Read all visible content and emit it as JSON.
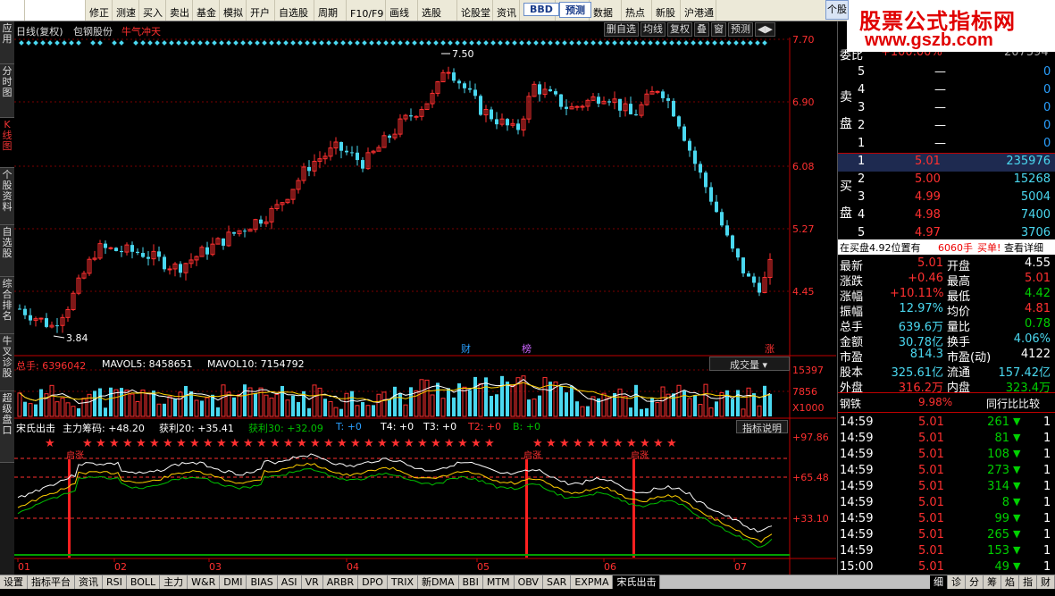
{
  "toolbar": {
    "items": [
      "",
      "",
      "修正",
      "测速",
      "买入",
      "卖出",
      "基金",
      "模拟",
      "开户",
      "自选股",
      "周期",
      "F10/F9",
      "画线",
      "选股",
      "论股堂",
      "资讯",
      "BBD",
      "预测",
      "数据",
      "热点",
      "新股",
      "沪港通",
      "个股"
    ]
  },
  "brand": {
    "line1": "股票公式指标网",
    "line2": "www.gszb.com"
  },
  "left_tabs": [
    "应用",
    "分时图",
    "K线图",
    "个股资料",
    "自选股",
    "综合排名",
    "牛叉诊股",
    "超级盘口"
  ],
  "chart_header": {
    "period": "日线(复权)",
    "name": "包钢股份",
    "tag": "牛气冲天",
    "buttons": [
      "删自选",
      "均线",
      "复权",
      "叠",
      "窗",
      "预测",
      "◀▶"
    ]
  },
  "price_axis": [
    "7.70",
    "6.90",
    "6.08",
    "5.27",
    "4.45"
  ],
  "annotations": {
    "high": "7.50",
    "low": "3.84",
    "marks": [
      "财",
      "榜",
      "涨"
    ]
  },
  "volume_header": {
    "total": "总手: 6396042",
    "mavol5": "MAVOL5: 8458651",
    "mavol10": "MAVOL10: 7154792",
    "selector": "成交量",
    "axis": [
      "15397",
      "7856",
      "X1000"
    ]
  },
  "indicator_header": {
    "name": "宋氏出击",
    "zl": "主力筹码: +48.20",
    "hl20": "获利20: +35.41",
    "hl30": "获利30: +32.09",
    "t": "T: +0",
    "t4": "T4: +0",
    "t3": "T3: +0",
    "t2": "T2: +0",
    "b": "B: +0",
    "help": "指标说明",
    "axis": [
      "+97.86",
      "+65.48",
      "+33.10"
    ],
    "labels": [
      "启涨",
      "启涨",
      "启涨"
    ]
  },
  "months": [
    "01",
    "02",
    "03",
    "04",
    "05",
    "06",
    "07"
  ],
  "quote": {
    "wei_bi": "委比",
    "wei_bi_val": "+100.00%",
    "wei_cha": "207594",
    "sell_label": "卖盘",
    "buy_label": "买盘",
    "sells": [
      {
        "n": "5",
        "p": "—",
        "v": "0"
      },
      {
        "n": "4",
        "p": "—",
        "v": "0"
      },
      {
        "n": "3",
        "p": "—",
        "v": "0"
      },
      {
        "n": "2",
        "p": "—",
        "v": "0"
      },
      {
        "n": "1",
        "p": "—",
        "v": "0"
      }
    ],
    "buys": [
      {
        "n": "1",
        "p": "5.01",
        "v": "235976"
      },
      {
        "n": "2",
        "p": "5.00",
        "v": "15268"
      },
      {
        "n": "3",
        "p": "4.99",
        "v": "5004"
      },
      {
        "n": "4",
        "p": "4.98",
        "v": "7400"
      },
      {
        "n": "5",
        "p": "4.97",
        "v": "3706"
      }
    ],
    "bar": {
      "left": "在买盘4.92位置有",
      "mid": "6060手",
      "buy": "买单!",
      "detail": "查看详细"
    },
    "stats": [
      {
        "l1": "最新",
        "v1": "5.01",
        "c1": "red",
        "l2": "开盘",
        "v2": "4.55",
        "c2": "white"
      },
      {
        "l1": "涨跌",
        "v1": "+0.46",
        "c1": "red",
        "l2": "最高",
        "v2": "5.01",
        "c2": "red"
      },
      {
        "l1": "涨幅",
        "v1": "+10.11%",
        "c1": "red",
        "l2": "最低",
        "v2": "4.42",
        "c2": "green"
      },
      {
        "l1": "振幅",
        "v1": "12.97%",
        "c1": "cyan",
        "l2": "均价",
        "v2": "4.81",
        "c2": "red"
      },
      {
        "l1": "总手",
        "v1": "639.6万",
        "c1": "cyan",
        "l2": "量比",
        "v2": "0.78",
        "c2": "green"
      },
      {
        "l1": "金额",
        "v1": "30.78亿",
        "c1": "cyan",
        "l2": "换手",
        "v2": "4.06%",
        "c2": "cyan"
      },
      {
        "l1": "市盈",
        "v1": "814.3",
        "c1": "cyan",
        "l2": "市盈(动)",
        "v2": "4122",
        "c2": "white"
      },
      {
        "l1": "股本",
        "v1": "325.61亿",
        "c1": "cyan",
        "l2": "流通",
        "v2": "157.42亿",
        "c2": "cyan"
      },
      {
        "l1": "外盘",
        "v1": "316.2万",
        "c1": "red",
        "l2": "内盘",
        "v2": "323.4万",
        "c2": "green"
      }
    ],
    "industry": {
      "name": "钢铁",
      "pct": "9.98%",
      "cmp": "同行比比较"
    },
    "ticks": [
      {
        "t": "14:59",
        "p": "5.01",
        "v": "261",
        "n": "1"
      },
      {
        "t": "14:59",
        "p": "5.01",
        "v": "81",
        "n": "1"
      },
      {
        "t": "14:59",
        "p": "5.01",
        "v": "108",
        "n": "1"
      },
      {
        "t": "14:59",
        "p": "5.01",
        "v": "273",
        "n": "1"
      },
      {
        "t": "14:59",
        "p": "5.01",
        "v": "314",
        "n": "1"
      },
      {
        "t": "14:59",
        "p": "5.01",
        "v": "8",
        "n": "1"
      },
      {
        "t": "14:59",
        "p": "5.01",
        "v": "99",
        "n": "1"
      },
      {
        "t": "14:59",
        "p": "5.01",
        "v": "265",
        "n": "1"
      },
      {
        "t": "14:59",
        "p": "5.01",
        "v": "153",
        "n": "1"
      },
      {
        "t": "15:00",
        "p": "5.01",
        "v": "49",
        "n": "1"
      }
    ]
  },
  "bottom_tabs": [
    "设置",
    "指标平台",
    "资讯",
    "RSI",
    "BOLL",
    "主力",
    "W&R",
    "DMI",
    "BIAS",
    "ASI",
    "VR",
    "ARBR",
    "DPO",
    "TRIX",
    "新DMA",
    "BBI",
    "MTM",
    "OBV",
    "SAR",
    "EXPMA",
    "宋氏出击"
  ],
  "right_bottom_tabs": [
    "细",
    "诊",
    "分",
    "筹",
    "焰",
    "指",
    "财"
  ],
  "colors": {
    "up": "#ff3030",
    "down": "#4ad8f0",
    "grid": "#7a0000",
    "axis": "#c00000"
  }
}
